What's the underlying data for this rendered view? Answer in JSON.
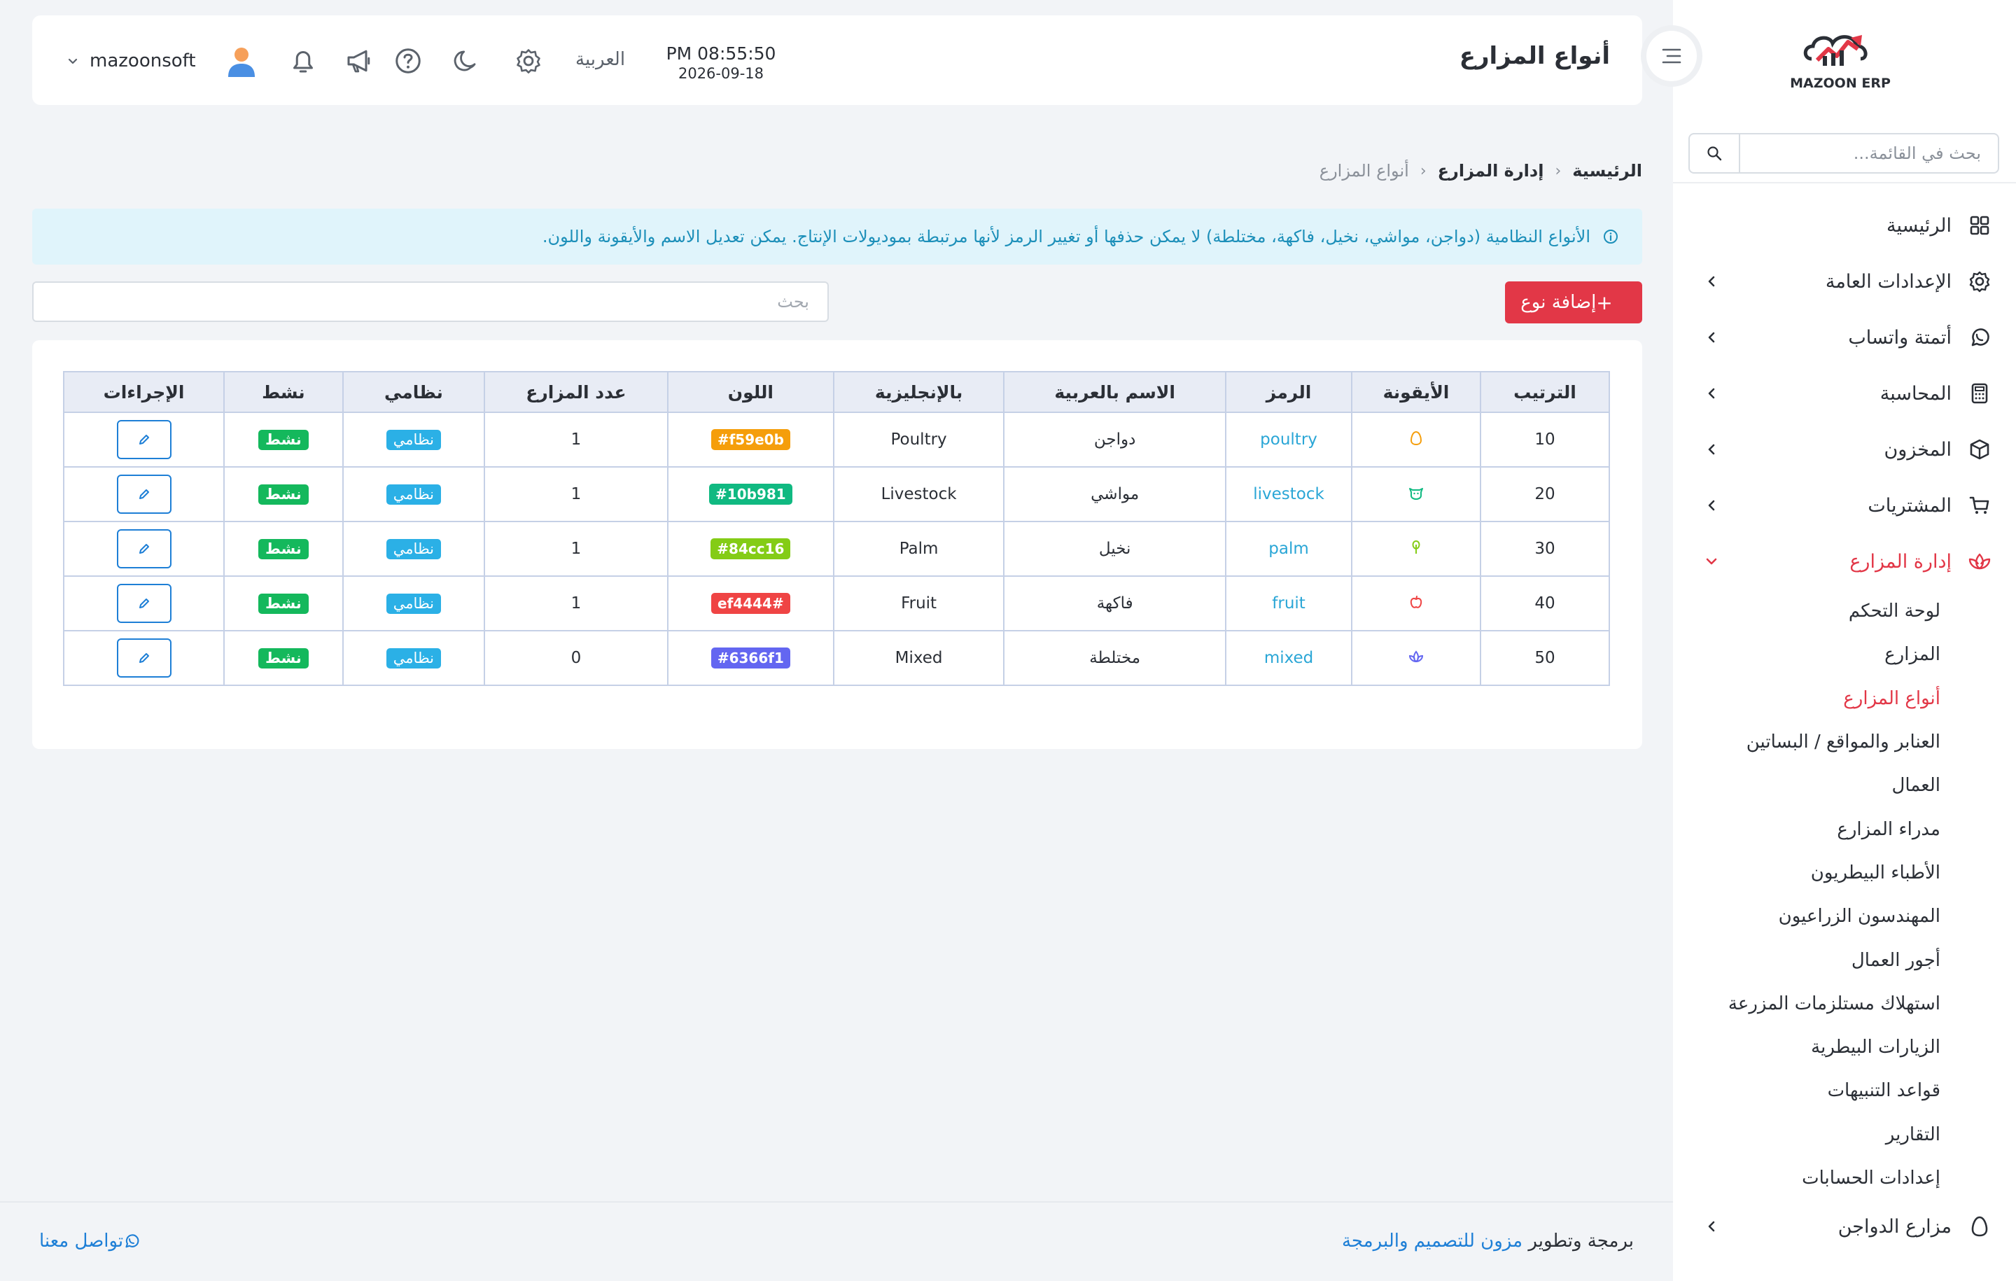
{
  "brand": {
    "logo_text": "MAZOON ERP"
  },
  "sidebar": {
    "search_placeholder": "بحث في القائمة...",
    "items": [
      {
        "label": "الرئيسية",
        "icon": "grid-icon",
        "has_chevron": false
      },
      {
        "label": "الإعدادات العامة",
        "icon": "gear-icon",
        "has_chevron": true
      },
      {
        "label": "أتمتة واتساب",
        "icon": "whatsapp-icon",
        "has_chevron": true
      },
      {
        "label": "المحاسبة",
        "icon": "calculator-icon",
        "has_chevron": true
      },
      {
        "label": "المخزون",
        "icon": "box-icon",
        "has_chevron": true
      },
      {
        "label": "المشتريات",
        "icon": "cart-icon",
        "has_chevron": true
      },
      {
        "label": "إدارة المزارع",
        "icon": "lotus-icon",
        "has_chevron": true,
        "active": true
      }
    ],
    "subitems": [
      {
        "label": "لوحة التحكم"
      },
      {
        "label": "المزارع"
      },
      {
        "label": "أنواع المزارع",
        "active": true
      },
      {
        "label": "العنابر والمواقع / البساتين"
      },
      {
        "label": "العمال"
      },
      {
        "label": "مدراء المزارع"
      },
      {
        "label": "الأطباء البيطريون"
      },
      {
        "label": "المهندسون الزراعيون"
      },
      {
        "label": "أجور العمال"
      },
      {
        "label": "استهلاك مستلزمات المزرعة"
      },
      {
        "label": "الزيارات البيطرية"
      },
      {
        "label": "قواعد التنبيهات"
      },
      {
        "label": "التقارير"
      },
      {
        "label": "إعدادات الحسابات"
      }
    ],
    "bottom_item": {
      "label": "مزارع الدواجن",
      "icon": "egg-icon"
    }
  },
  "header": {
    "title": "أنواع المزارع",
    "time": "PM 08:55:50",
    "date": "2026-09-18",
    "language": "العربية",
    "username": "mazoonsoft"
  },
  "breadcrumb": {
    "home": "الرئيسية",
    "parent": "إدارة المزارع",
    "current": "أنواع المزارع"
  },
  "alert": {
    "text": "الأنواع النظامية (دواجن، مواشي، نخيل، فاكهة، مختلطة) لا يمكن حذفها أو تغيير الرمز لأنها مرتبطة بموديولات الإنتاج. يمكن تعديل الاسم والأيقونة واللون."
  },
  "toolbar": {
    "add_label": "إضافة نوع",
    "search_placeholder": "بحث"
  },
  "table": {
    "headers": [
      "الترتيب",
      "الأيقونة",
      "الرمز",
      "الاسم بالعربية",
      "بالإنجليزية",
      "اللون",
      "عدد المزارع",
      "نظامي",
      "نشط",
      "الإجراءات"
    ],
    "rows": [
      {
        "order": "10",
        "icon": "egg-icon",
        "code": "poultry",
        "name_ar": "دواجن",
        "name_en": "Poultry",
        "color": "#f59e0b",
        "color_label": "f59e0b#",
        "farms": "1",
        "system": "نظامي",
        "active": "نشط"
      },
      {
        "order": "20",
        "icon": "cow-icon",
        "code": "livestock",
        "name_ar": "مواشي",
        "name_en": "Livestock",
        "color": "#10b981",
        "color_label": "#10b981",
        "farms": "1",
        "system": "نظامي",
        "active": "نشط"
      },
      {
        "order": "30",
        "icon": "tree-icon",
        "code": "palm",
        "name_ar": "نخيل",
        "name_en": "Palm",
        "color": "#84cc16",
        "color_label": "#84cc16",
        "farms": "1",
        "system": "نظامي",
        "active": "نشط"
      },
      {
        "order": "40",
        "icon": "apple-icon",
        "code": "fruit",
        "name_ar": "فاكهة",
        "name_en": "Fruit",
        "color": "#ef4444",
        "color_label": "ef4444#",
        "farms": "1",
        "system": "نظامي",
        "active": "نشط"
      },
      {
        "order": "50",
        "icon": "flower-icon",
        "code": "mixed",
        "name_ar": "مختلطة",
        "name_en": "Mixed",
        "color": "#6366f1",
        "color_label": "#6366f1",
        "farms": "0",
        "system": "نظامي",
        "active": "نشط"
      }
    ]
  },
  "footer": {
    "credit_prefix": "برمجة وتطوير",
    "credit_link": "مزون للتصميم والبرمجة",
    "contact": "تواصل معنا"
  },
  "colors": {
    "accent": "#e23747",
    "info": "#1c8fb9",
    "link": "#1e7fd6",
    "system_badge": "#2bb0e6",
    "active_badge": "#14b85c"
  }
}
